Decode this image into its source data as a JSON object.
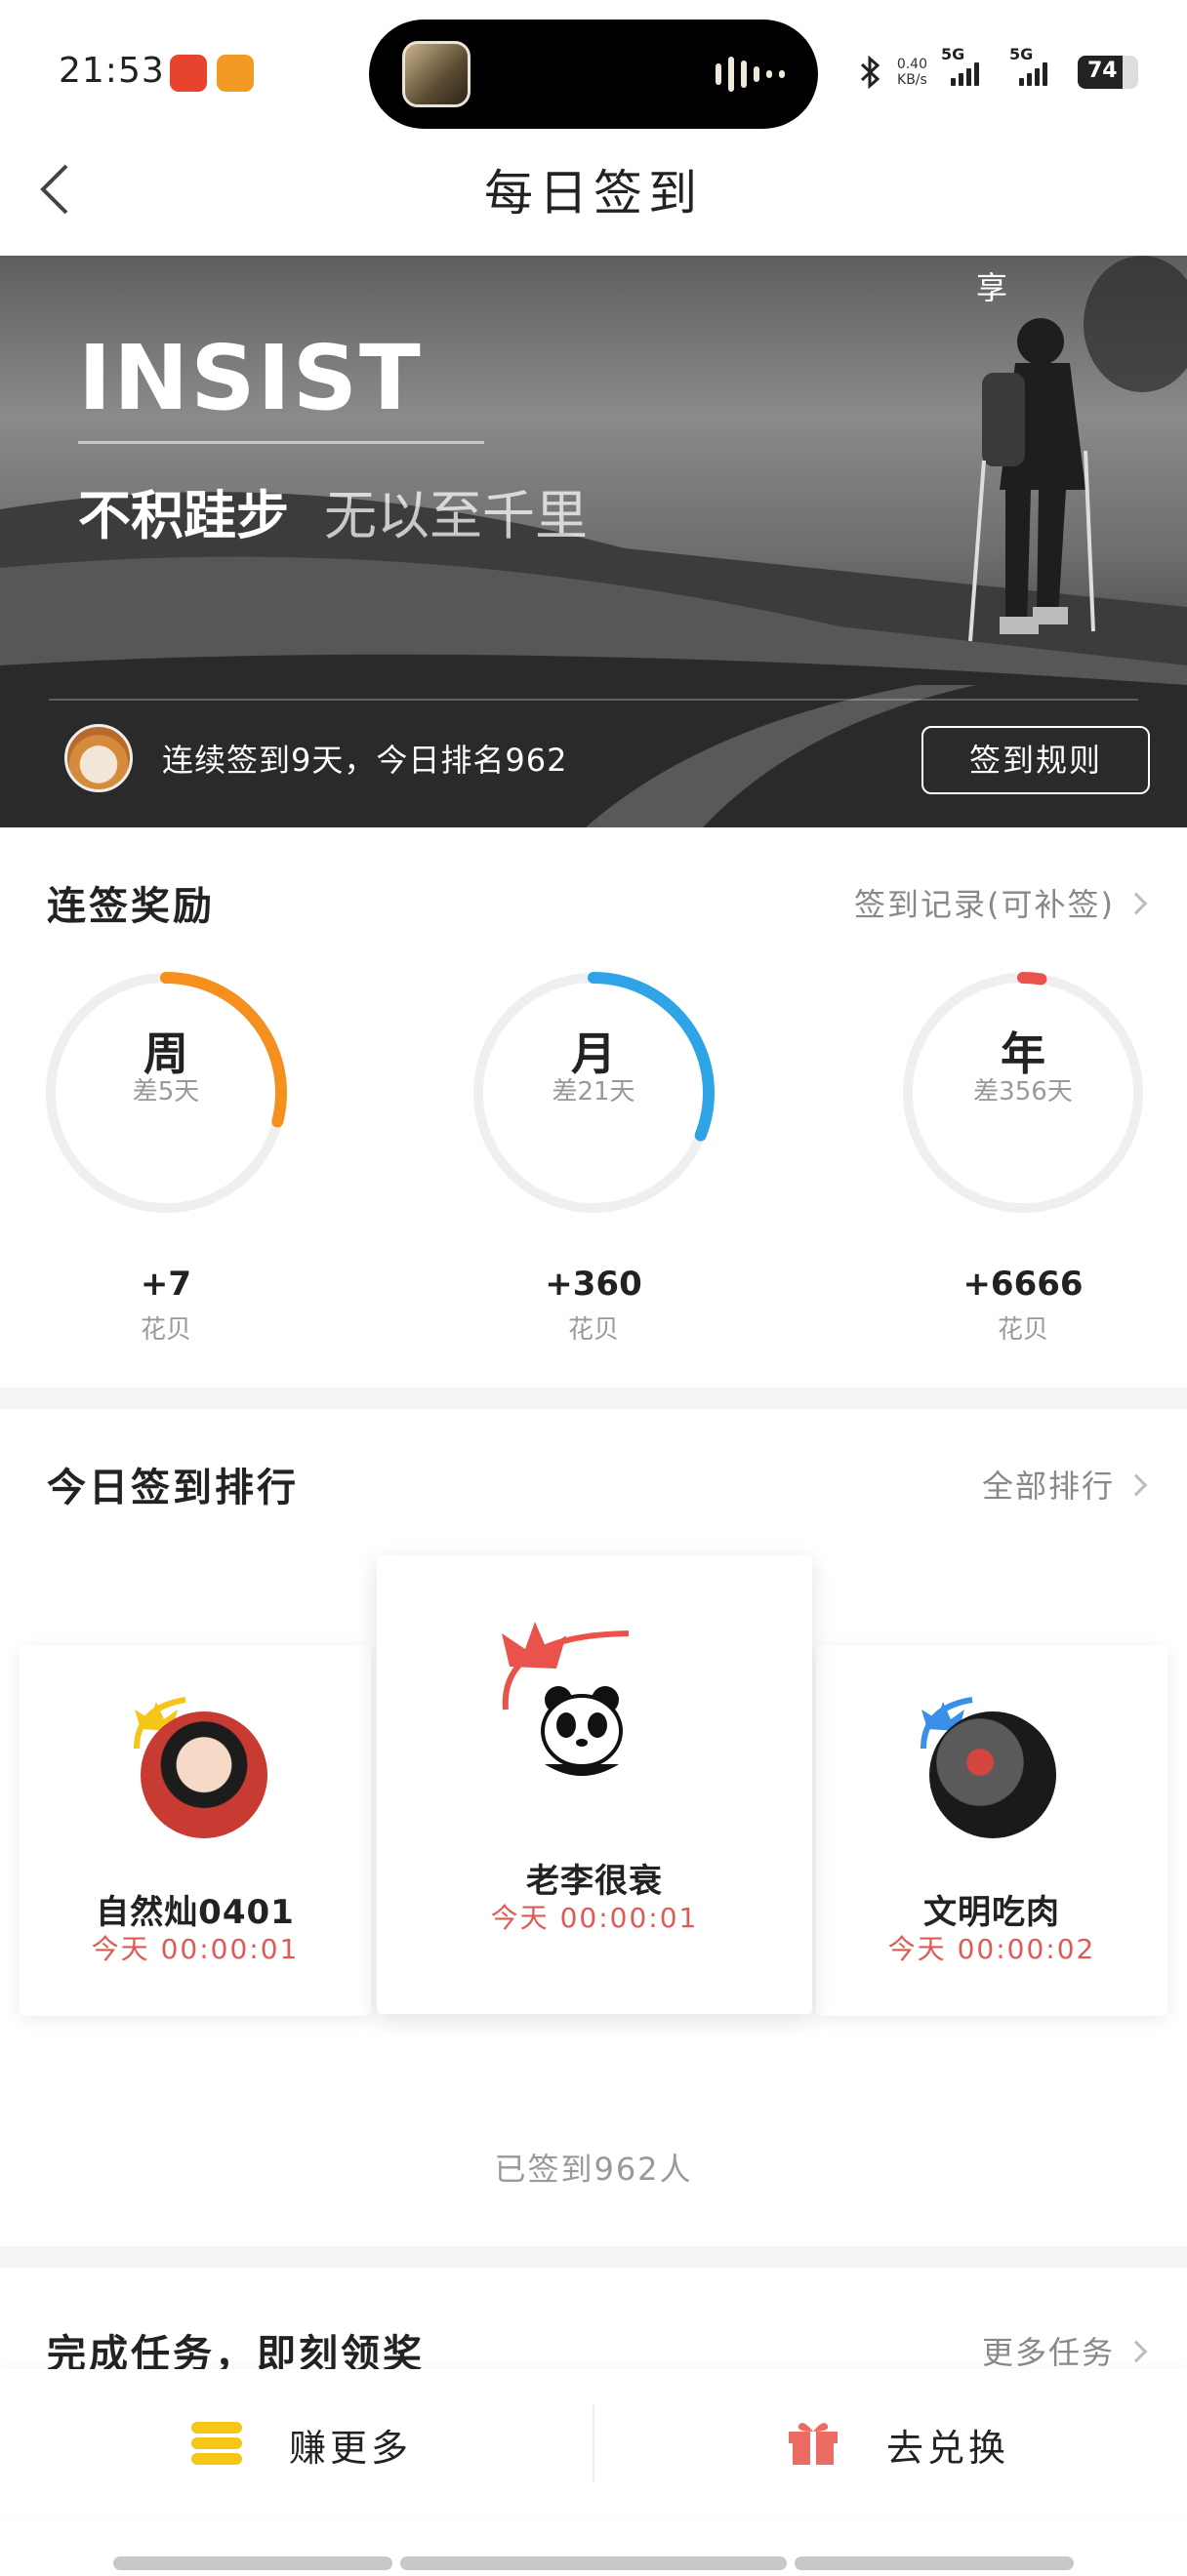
{
  "status_bar": {
    "time": "21:53",
    "net_speed_value": "0.40",
    "net_speed_unit": "KB/s",
    "sig1_label": "5G",
    "sig2_label": "5G",
    "battery": "74"
  },
  "nav": {
    "title": "每日签到"
  },
  "hero": {
    "headline": "INSIST",
    "slogan_main": "不积跬步",
    "slogan_sub": "无以至千里",
    "share_label": "享",
    "streak_text": "连续签到9天，今日排名962",
    "rules_button": "签到规则"
  },
  "streak_rewards": {
    "title": "连签奖励",
    "record_link": "签到记录(可补签)",
    "items": [
      {
        "label": "周",
        "remaining": "差5天",
        "value": "+7",
        "unit": "花贝",
        "progress": 0.29,
        "color": "#f5901e"
      },
      {
        "label": "月",
        "remaining": "差21天",
        "value": "+360",
        "unit": "花贝",
        "progress": 0.31,
        "color": "#2ea3e6"
      },
      {
        "label": "年",
        "remaining": "差356天",
        "value": "+6666",
        "unit": "花贝",
        "progress": 0.025,
        "color": "#e9534b"
      }
    ]
  },
  "ranking": {
    "title": "今日签到排行",
    "all_link": "全部排行",
    "entries": [
      {
        "position": 2,
        "name": "自然灿0401",
        "time": "今天 00:00:01"
      },
      {
        "position": 1,
        "name": "老李很衰",
        "time": "今天 00:00:01"
      },
      {
        "position": 3,
        "name": "文明吃肉",
        "time": "今天 00:00:02"
      }
    ],
    "checked_in_total": "已签到962人"
  },
  "tasks": {
    "title": "完成任务，即刻领奖",
    "more_link": "更多任务"
  },
  "bottom_bar": {
    "earn_label": "赚更多",
    "redeem_label": "去兑换"
  }
}
